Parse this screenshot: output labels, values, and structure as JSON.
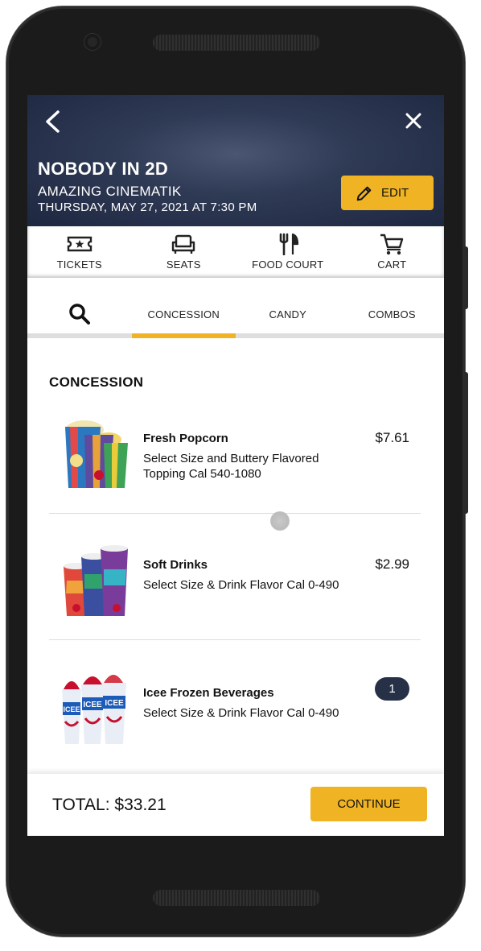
{
  "header": {
    "movie_title": "NOBODY IN 2D",
    "theater": "AMAZING CINEMATIK",
    "showtime": "THURSDAY, MAY 27, 2021 AT 7:30 PM",
    "edit_label": "EDIT",
    "back_icon": "chevron-left-icon",
    "close_icon": "close-icon"
  },
  "steps": [
    {
      "label": "TICKETS",
      "icon": "ticket-icon"
    },
    {
      "label": "SEATS",
      "icon": "sofa-icon"
    },
    {
      "label": "FOOD COURT",
      "icon": "fork-knife-icon"
    },
    {
      "label": "CART",
      "icon": "cart-icon"
    }
  ],
  "tabs": [
    {
      "label": "",
      "icon": "search-icon"
    },
    {
      "label": "CONCESSION",
      "active": true
    },
    {
      "label": "CANDY"
    },
    {
      "label": "COMBOS"
    }
  ],
  "section": {
    "title": "CONCESSION"
  },
  "items": [
    {
      "name": "Fresh Popcorn",
      "description": "Select Size and Buttery Flavored Topping Cal 540-1080",
      "price": "$7.61",
      "image": "popcorn-image"
    },
    {
      "name": "Soft Drinks",
      "description": "Select Size & Drink Flavor Cal 0-490",
      "price": "$2.99",
      "image": "soft-drinks-image"
    },
    {
      "name": "Icee Frozen Beverages",
      "description": "Select Size & Drink Flavor Cal 0-490",
      "quantity": "1",
      "image": "icee-image",
      "image_text": "ICEE"
    }
  ],
  "footer": {
    "total": "TOTAL: $33.21",
    "continue_label": "CONTINUE"
  },
  "colors": {
    "accent": "#f0b323",
    "header_bg": "#2f3a55",
    "badge_bg": "#263148"
  }
}
